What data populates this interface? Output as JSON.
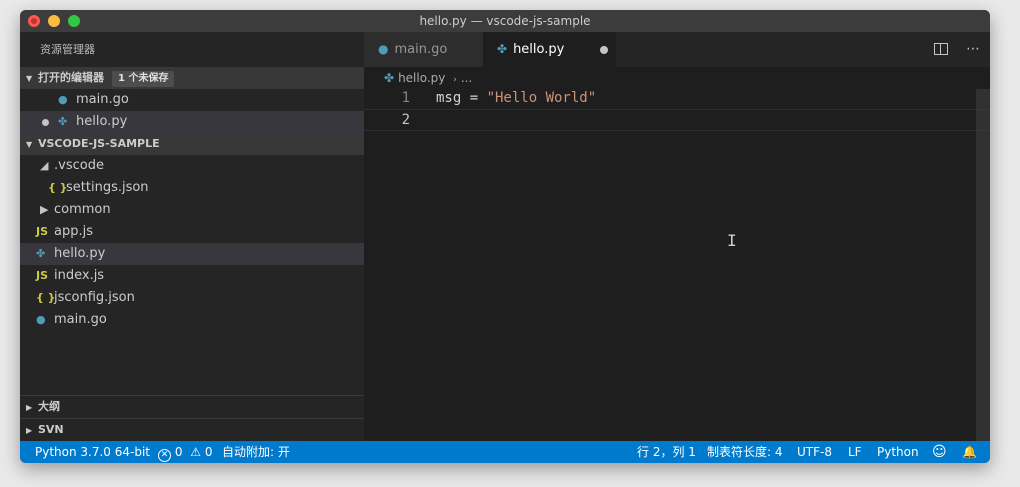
{
  "window": {
    "title": "hello.py — vscode-js-sample"
  },
  "sidebar": {
    "header": "资源管理器",
    "open_editors": {
      "title": "打开的编辑器",
      "badge": "1 个未保存",
      "items": [
        {
          "name": "main.go",
          "icon": "go-gopher-icon"
        },
        {
          "name": "hello.py",
          "icon": "python-icon",
          "modified": true
        }
      ]
    },
    "workspace": {
      "title": "VSCODE-JS-SAMPLE",
      "items": [
        {
          "name": ".vscode",
          "type": "folder-expanded"
        },
        {
          "name": "settings.json",
          "icon_glyph": "{ }"
        },
        {
          "name": "common",
          "type": "folder-collapsed"
        },
        {
          "name": "app.js",
          "icon_glyph": "JS"
        },
        {
          "name": "hello.py",
          "icon": "python-icon"
        },
        {
          "name": "index.js",
          "icon_glyph": "JS"
        },
        {
          "name": "jsconfig.json",
          "icon_glyph": "{ }"
        },
        {
          "name": "main.go",
          "icon": "go-gopher-icon"
        }
      ]
    },
    "bottom_sections": [
      {
        "title": "大纲"
      },
      {
        "title": "SVN"
      }
    ]
  },
  "editor": {
    "tabs": [
      {
        "label": "main.go",
        "active": false
      },
      {
        "label": "hello.py",
        "active": true,
        "modified": true
      }
    ],
    "breadcrumb": {
      "file": "hello.py",
      "more": "..."
    },
    "lines": [
      {
        "num": "1",
        "code_plain": "msg = ",
        "code_string": "\"Hello World\""
      },
      {
        "num": "2",
        "code_plain": "",
        "code_string": ""
      }
    ]
  },
  "statusbar": {
    "interpreter": "Python 3.7.0 64-bit",
    "errors": "0",
    "warnings": "0",
    "auto_attach": "自动附加: 开",
    "position": "行 2，列 1",
    "indent": "制表符长度: 4",
    "encoding": "UTF-8",
    "eol": "LF",
    "language": "Python"
  },
  "colors": {
    "accent": "#007acc",
    "string": "#ce9178",
    "file_icon_blue": "#519aba",
    "json_js_yellow": "#cbcb41"
  }
}
